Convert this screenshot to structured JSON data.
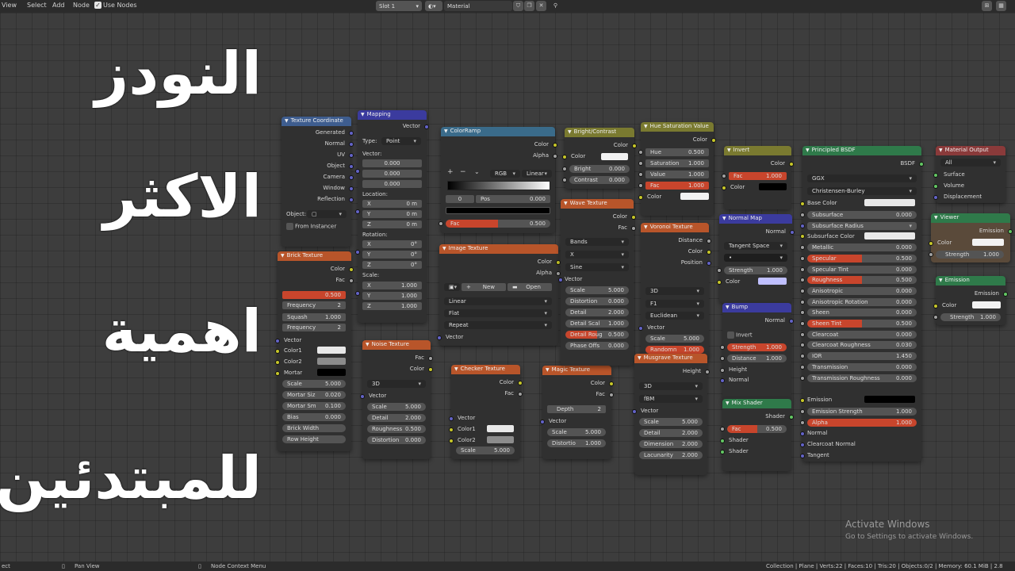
{
  "header": {
    "menus": [
      "View",
      "Select",
      "Add",
      "Node"
    ],
    "use_nodes_label": "Use Nodes",
    "slot": "Slot 1",
    "material": "Material"
  },
  "footer": {
    "left": "ect",
    "pan": "Pan View",
    "context": "Node Context Menu",
    "stats": "Collection | Plane | Verts:22 | Faces:10 | Tris:20 | Objects:0/2 | Memory: 60.1 MiB | 2.8"
  },
  "overlay": {
    "lines": [
      "النودز",
      "الاكثر",
      "اهمية",
      "للمبتدئين"
    ]
  },
  "watermark": {
    "title": "Activate Windows",
    "subtitle": "Go to Settings to activate Windows."
  },
  "colors": {
    "input_header": "#3e5d8f",
    "texture_header": "#b8552a",
    "vector_header": "#3b3b9e",
    "color_header": "#7a7a30",
    "converter_header": "#3a6b8a",
    "shader_header": "#2f7a4a",
    "output_header": "#8a3a3a",
    "field_active": "#c8452c"
  },
  "nodes": {
    "texcoord": {
      "title": "Texture Coordinate",
      "outputs": [
        "Generated",
        "Normal",
        "UV",
        "Object",
        "Camera",
        "Window",
        "Reflection"
      ],
      "object_label": "Object:",
      "from_instancer": "From Instancer"
    },
    "mapping": {
      "title": "Mapping",
      "out": "Vector",
      "type_label": "Type:",
      "type_value": "Point",
      "vector_label": "Vector:",
      "vector_values": [
        "0.000",
        "0.000",
        "0.000"
      ],
      "location_label": "Location:",
      "location": [
        {
          "k": "X",
          "v": "0 m"
        },
        {
          "k": "Y",
          "v": "0 m"
        },
        {
          "k": "Z",
          "v": "0 m"
        }
      ],
      "rotation_label": "Rotation:",
      "rotation": [
        {
          "k": "X",
          "v": "0°"
        },
        {
          "k": "Y",
          "v": "0°"
        },
        {
          "k": "Z",
          "v": "0°"
        }
      ],
      "scale_label": "Scale:",
      "scale": [
        {
          "k": "X",
          "v": "1.000"
        },
        {
          "k": "Y",
          "v": "1.000"
        },
        {
          "k": "Z",
          "v": "1.000"
        }
      ]
    },
    "colorramp": {
      "title": "ColorRamp",
      "outputs": [
        "Color",
        "Alpha"
      ],
      "mode": "RGB",
      "interp": "Linear",
      "index": "0",
      "pos_label": "Pos",
      "pos": "0.000",
      "fac": "Fac",
      "fac_val": "0.500"
    },
    "brick": {
      "title": "Brick Texture",
      "outputs": [
        "Color",
        "Fac"
      ],
      "f1_val": "0.500",
      "freq_label": "Frequency",
      "freq": "2",
      "squash_label": "Squash",
      "squash": "1.000",
      "freq2_label": "Frequency",
      "freq2": "2",
      "vector": "Vector",
      "color1": "Color1",
      "color2": "Color2",
      "mortar": "Mortar",
      "scale": "Scale",
      "scale_v": "5.000",
      "mortar_size": "Mortar Siz",
      "mortar_size_v": "0.020",
      "mortar_smooth": "Mortar Sm",
      "mortar_smooth_v": "0.100",
      "bias": "Bias",
      "bias_v": "0.000",
      "brick_width": "Brick Width",
      "row_height": "Row Height"
    },
    "image": {
      "title": "Image Texture",
      "outputs": [
        "Color",
        "Alpha"
      ],
      "new": "New",
      "open": "Open",
      "interp": "Linear",
      "proj": "Flat",
      "ext": "Repeat",
      "vector": "Vector"
    },
    "noise": {
      "title": "Noise Texture",
      "outputs": [
        "Fac",
        "Color"
      ],
      "dim": "3D",
      "vector": "Vector",
      "scale": "Scale",
      "scale_v": "5.000",
      "detail": "Detail",
      "detail_v": "2.000",
      "rough": "Roughness",
      "rough_v": "0.500",
      "dist": "Distortion",
      "dist_v": "0.000"
    },
    "checker": {
      "title": "Checker Texture",
      "outputs": [
        "Color",
        "Fac"
      ],
      "vector": "Vector",
      "color1": "Color1",
      "color2": "Color2",
      "scale": "Scale",
      "scale_v": "5.000"
    },
    "magic": {
      "title": "Magic Texture",
      "outputs": [
        "Color",
        "Fac"
      ],
      "depth": "Depth",
      "depth_v": "2",
      "vector": "Vector",
      "scale": "Scale",
      "scale_v": "5.000",
      "dist": "Distortio",
      "dist_v": "1.000"
    },
    "bright": {
      "title": "Bright/Contrast",
      "out": "Color",
      "color": "Color",
      "bright": "Bright",
      "bright_v": "0.000",
      "contrast": "Contrast",
      "contrast_v": "0.000"
    },
    "wave": {
      "title": "Wave Texture",
      "outputs": [
        "Color",
        "Fac"
      ],
      "type": "Bands",
      "dir": "X",
      "profile": "Sine",
      "vector": "Vector",
      "scale": "Scale",
      "scale_v": "5.000",
      "dist": "Distortion",
      "dist_v": "0.000",
      "detail": "Detail",
      "detail_v": "2.000",
      "dscale": "Detail Scal",
      "dscale_v": "1.000",
      "drough": "Detail Roug",
      "drough_v": "0.500",
      "phase": "Phase Offs",
      "phase_v": "0.000"
    },
    "huesat": {
      "title": "Hue Saturation Value",
      "out": "Color",
      "hue": "Hue",
      "hue_v": "0.500",
      "sat": "Saturation",
      "sat_v": "1.000",
      "val": "Value",
      "val_v": "1.000",
      "fac": "Fac",
      "fac_v": "1.000",
      "color": "Color"
    },
    "voronoi": {
      "title": "Voronoi Texture",
      "outputs": [
        "Distance",
        "Color",
        "Position"
      ],
      "dim": "3D",
      "feature": "F1",
      "metric": "Euclidean",
      "vector": "Vector",
      "scale": "Scale",
      "scale_v": "5.000",
      "random": "Randomn",
      "random_v": "1.000"
    },
    "musgrave": {
      "title": "Musgrave Texture",
      "out": "Height",
      "dim": "3D",
      "type": "fBM",
      "vector": "Vector",
      "scale": "Scale",
      "scale_v": "5.000",
      "detail": "Detail",
      "detail_v": "2.000",
      "dimension": "Dimension",
      "dimension_v": "2.000",
      "lac": "Lacunarity",
      "lac_v": "2.000"
    },
    "invert": {
      "title": "Invert",
      "out": "Color",
      "fac": "Fac",
      "fac_v": "1.000",
      "color": "Color"
    },
    "normalmap": {
      "title": "Normal Map",
      "out": "Normal",
      "space": "Tangent Space",
      "strength": "Strength",
      "strength_v": "1.000",
      "color": "Color"
    },
    "bump": {
      "title": "Bump",
      "out": "Normal",
      "invert": "Invert",
      "strength": "Strength",
      "strength_v": "1.000",
      "distance": "Distance",
      "distance_v": "1.000",
      "height": "Height",
      "normal": "Normal"
    },
    "mix": {
      "title": "Mix Shader",
      "out": "Shader",
      "fac": "Fac",
      "fac_v": "0.500",
      "s1": "Shader",
      "s2": "Shader"
    },
    "bsdf": {
      "title": "Principled BSDF",
      "out": "BSDF",
      "dist": "GGX",
      "ss_method": "Christensen-Burley",
      "base": "Base Color",
      "props": [
        {
          "k": "Subsurface",
          "v": "0.000",
          "o": false
        },
        {
          "k": "Subsurface Radius",
          "v": "",
          "o": false,
          "sel": true
        },
        {
          "k": "Subsurface Color",
          "v": "",
          "o": false,
          "sw": true
        },
        {
          "k": "Metallic",
          "v": "0.000",
          "o": false
        },
        {
          "k": "Specular",
          "v": "0.500",
          "o": true
        },
        {
          "k": "Specular Tint",
          "v": "0.000",
          "o": false
        },
        {
          "k": "Roughness",
          "v": "0.500",
          "o": true
        },
        {
          "k": "Anisotropic",
          "v": "0.000",
          "o": false
        },
        {
          "k": "Anisotropic Rotation",
          "v": "0.000",
          "o": false
        },
        {
          "k": "Sheen",
          "v": "0.000",
          "o": false
        },
        {
          "k": "Sheen Tint",
          "v": "0.500",
          "o": true
        },
        {
          "k": "Clearcoat",
          "v": "0.000",
          "o": false
        },
        {
          "k": "Clearcoat Roughness",
          "v": "0.030",
          "o": false
        },
        {
          "k": "IOR",
          "v": "1.450",
          "o": false
        },
        {
          "k": "Transmission",
          "v": "0.000",
          "o": false
        },
        {
          "k": "Transmission Roughness",
          "v": "0.000",
          "o": false
        }
      ],
      "emission": "Emission",
      "emis_strength": "Emission Strength",
      "emis_strength_v": "1.000",
      "alpha": "Alpha",
      "alpha_v": "1.000",
      "normal": "Normal",
      "cc_normal": "Clearcoat Normal",
      "tangent": "Tangent"
    },
    "matout": {
      "title": "Material Output",
      "target": "All",
      "inputs": [
        "Surface",
        "Volume",
        "Displacement"
      ]
    },
    "viewer": {
      "title": "Viewer",
      "out": "Emission",
      "color": "Color",
      "strength": "Strength",
      "strength_v": "1.000"
    },
    "emission": {
      "title": "Emission",
      "out": "Emission",
      "color": "Color",
      "strength": "Strength",
      "strength_v": "1.000"
    }
  }
}
